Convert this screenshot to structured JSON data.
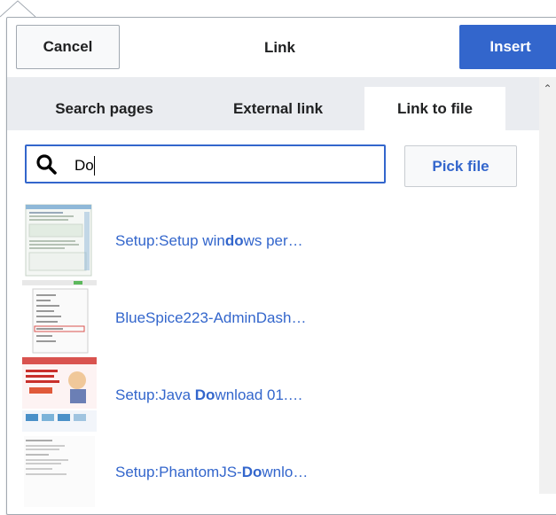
{
  "dialog": {
    "title": "Link",
    "cancel_label": "Cancel",
    "insert_label": "Insert",
    "accent_color": "#3366cc"
  },
  "tabs": [
    {
      "label": "Search pages",
      "active": false
    },
    {
      "label": "External link",
      "active": false
    },
    {
      "label": "Link to file",
      "active": true
    }
  ],
  "search": {
    "value": "Do",
    "icon": "search-icon"
  },
  "pick_file_label": "Pick file",
  "results": [
    {
      "pre": "Setup:Setup win",
      "match": "do",
      "post": "ws per…",
      "thumb": "setup-windows-thumbnail"
    },
    {
      "pre": "BlueSpice223-AdminDash…",
      "match": "",
      "post": "",
      "thumb": "admin-dashboard-thumbnail"
    },
    {
      "pre": "Setup:Java ",
      "match": "Do",
      "post": "wnload 01.…",
      "thumb": "java-download-thumbnail"
    },
    {
      "pre": "Setup:PhantomJS-",
      "match": "Do",
      "post": "wnlo…",
      "thumb": "phantomjs-download-thumbnail"
    }
  ]
}
